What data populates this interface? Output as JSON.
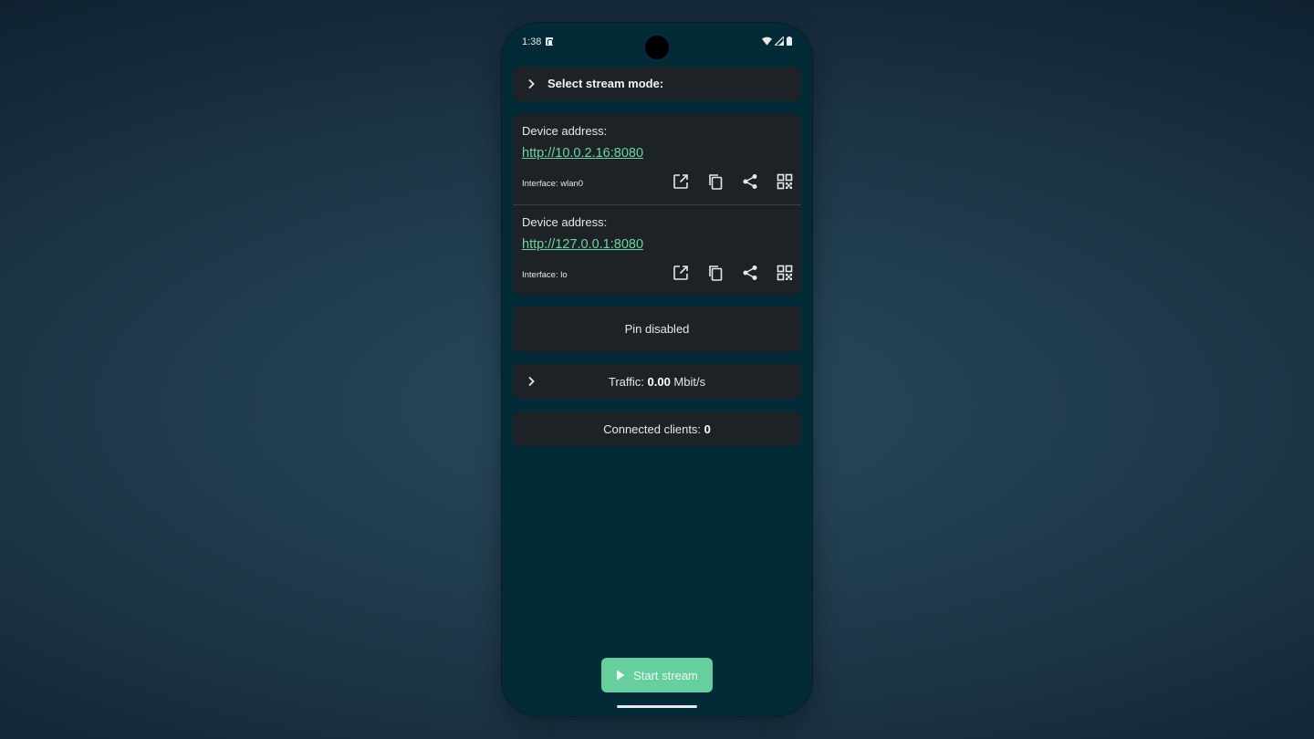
{
  "status_bar": {
    "time": "1:38",
    "icons": [
      "notification-a-icon",
      "wifi-icon",
      "signal-icon",
      "battery-icon"
    ]
  },
  "stream_mode": {
    "label": "Select stream mode:",
    "icon": "chevron-right-icon"
  },
  "addresses": [
    {
      "title": "Device address:",
      "url": "http://10.0.2.16:8080",
      "interface": "Interface: wlan0",
      "actions": [
        "open-in-new-icon",
        "copy-icon",
        "share-icon",
        "qr-code-icon"
      ]
    },
    {
      "title": "Device address:",
      "url": "http://127.0.0.1:8080",
      "interface": "Interface: lo",
      "actions": [
        "open-in-new-icon",
        "copy-icon",
        "share-icon",
        "qr-code-icon"
      ]
    }
  ],
  "pin": {
    "label": "Pin disabled"
  },
  "traffic": {
    "prefix": "Traffic: ",
    "value": "0.00",
    "unit": " Mbit/s",
    "icon": "chevron-right-icon"
  },
  "clients": {
    "prefix": "Connected clients: ",
    "value": "0"
  },
  "start_button": {
    "label": "Start stream",
    "icon": "play-icon"
  },
  "colors": {
    "background": "#032a37",
    "card": "#1d2226",
    "link": "#6fd3a3",
    "accent": "#66cf9d"
  }
}
